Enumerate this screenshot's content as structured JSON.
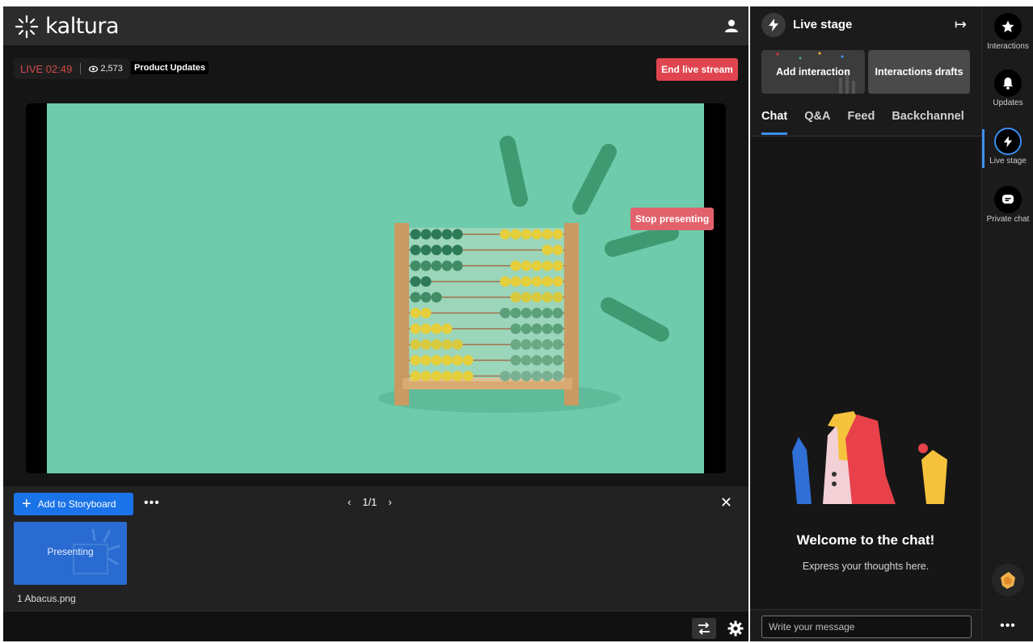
{
  "app": {
    "brand": "kaltura"
  },
  "header": {
    "live_label": "LIVE 02:49",
    "viewers": "2,573",
    "stream_title": "Product Updates",
    "end_button": "End live stream"
  },
  "stage": {
    "stop_button": "Stop presenting"
  },
  "storyboard": {
    "add_button": "Add to Storyboard",
    "page_indicator": "1/1",
    "thumb_state": "Presenting",
    "thumb_name": "1 Abacus.png"
  },
  "panel": {
    "title": "Live stage",
    "add_interaction": "Add interaction",
    "interactions_drafts": "Interactions drafts",
    "tabs": [
      {
        "label": "Chat",
        "active": true
      },
      {
        "label": "Q&A",
        "active": false
      },
      {
        "label": "Feed",
        "active": false
      },
      {
        "label": "Backchannel",
        "active": false
      }
    ],
    "welcome_title": "Welcome to the chat!",
    "welcome_sub": "Express your thoughts here.",
    "message_placeholder": "Write your message"
  },
  "rail": [
    {
      "label": "Interactions",
      "icon": "star-icon"
    },
    {
      "label": "Updates",
      "icon": "bell-icon"
    },
    {
      "label": "Live stage",
      "icon": "bolt-icon",
      "active": true
    },
    {
      "label": "Private chat",
      "icon": "chat-icon"
    }
  ],
  "colors": {
    "accent_blue": "#1a73e8",
    "danger": "#e0454f",
    "slide_bg": "#6ecbab"
  }
}
